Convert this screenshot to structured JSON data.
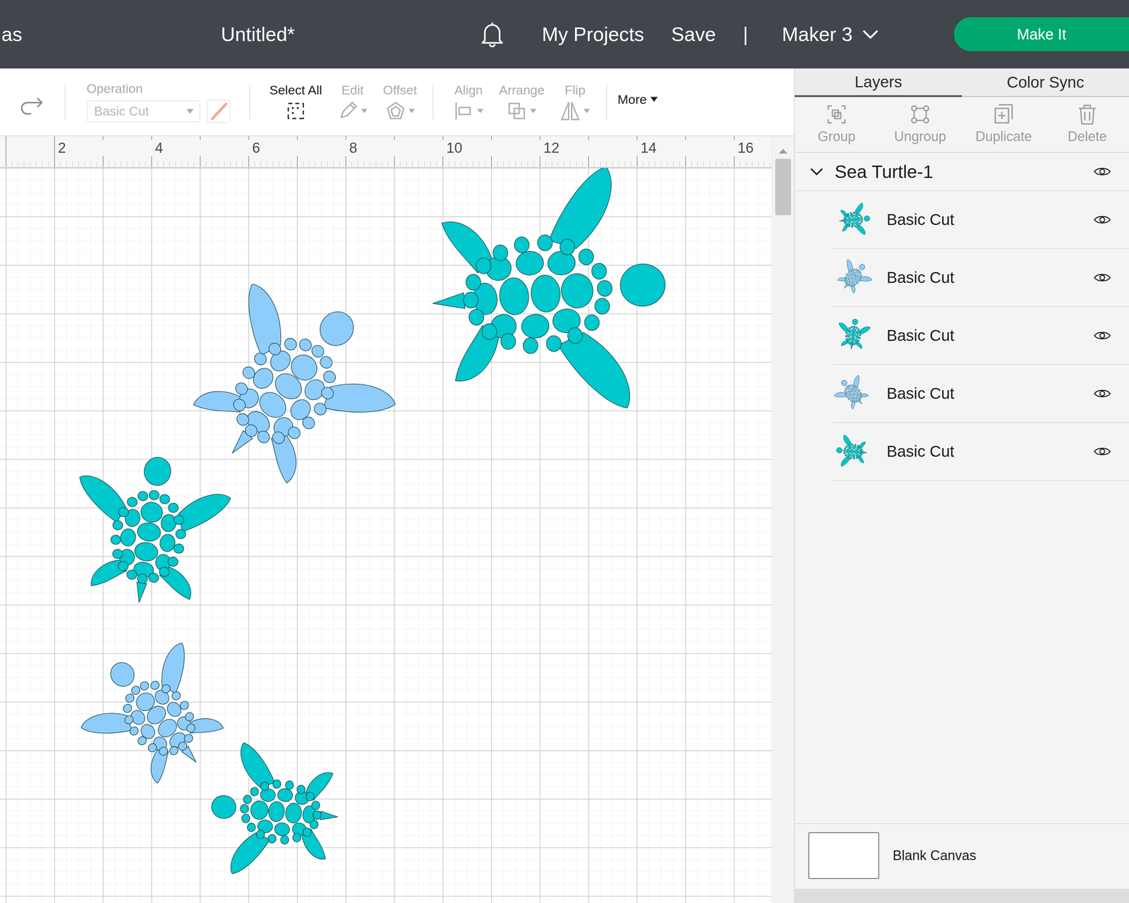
{
  "top_bar": {
    "left_cut": "as",
    "title": "Untitled*",
    "links": [
      "My Projects",
      "Save"
    ],
    "separator": "|",
    "machine": "Maker 3",
    "make_it": "Make It"
  },
  "toolbar": {
    "operation": {
      "label": "Operation",
      "value": "Basic Cut",
      "disabled": true
    },
    "tools": [
      {
        "label": "Select All",
        "disabled": false
      },
      {
        "label": "Edit",
        "disabled": true
      },
      {
        "label": "Offset",
        "disabled": true
      },
      {
        "label": "Align",
        "disabled": true
      },
      {
        "label": "Arrange",
        "disabled": true
      },
      {
        "label": "Flip",
        "disabled": true
      }
    ],
    "more": "More"
  },
  "ruler": {
    "ticks": [
      "2",
      "4",
      "6",
      "8",
      "10",
      "12",
      "14",
      "16"
    ]
  },
  "panel": {
    "tabs": [
      {
        "label": "Layers",
        "selected": true
      },
      {
        "label": "Color Sync",
        "selected": false
      }
    ],
    "actions": [
      {
        "label": "Group",
        "disabled": true
      },
      {
        "label": "Ungroup",
        "disabled": true
      },
      {
        "label": "Duplicate",
        "disabled": true
      },
      {
        "label": "Delete",
        "disabled": true
      }
    ],
    "group": {
      "name": "Sea Turtle-1",
      "expanded": true,
      "visible": true
    },
    "layers": [
      {
        "name": "Basic Cut",
        "color": "#00c8cc",
        "visible": true
      },
      {
        "name": "Basic Cut",
        "color": "#8ecdfb",
        "visible": true
      },
      {
        "name": "Basic Cut",
        "color": "#00c8cc",
        "visible": true
      },
      {
        "name": "Basic Cut",
        "color": "#8ecdfb",
        "visible": true
      },
      {
        "name": "Basic Cut",
        "color": "#00c8cc",
        "visible": true
      }
    ],
    "canvas": {
      "label": "Blank Canvas",
      "color": "#ffffff"
    }
  }
}
